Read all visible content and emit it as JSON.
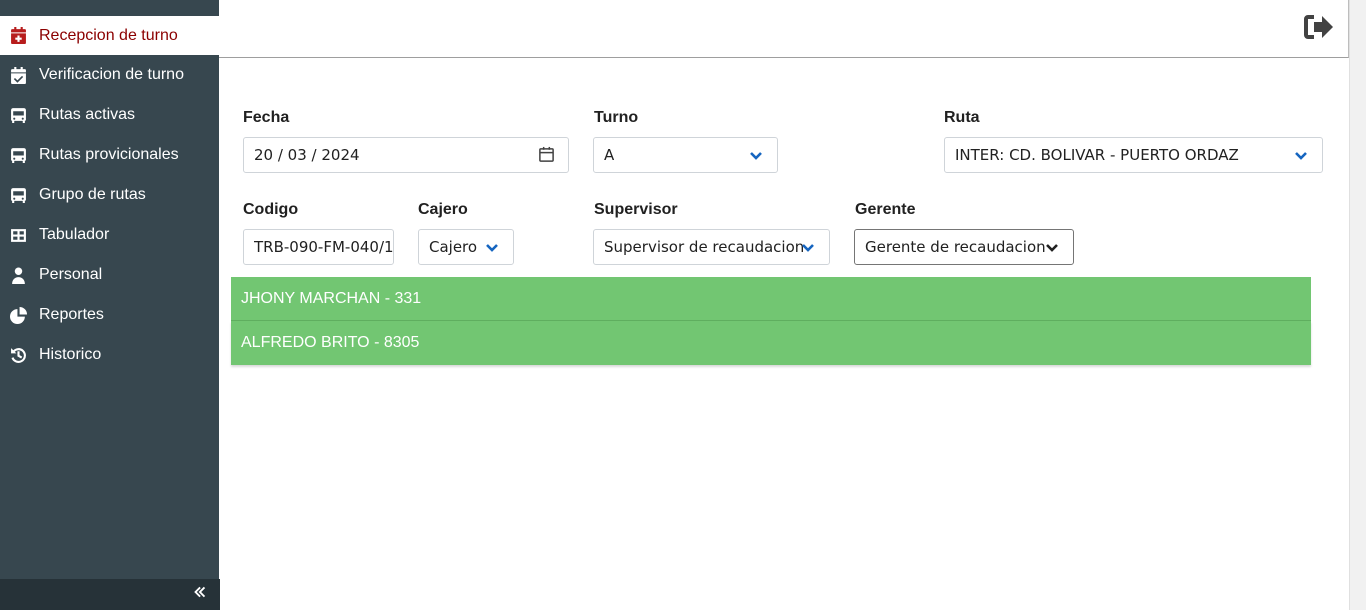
{
  "sidebar": {
    "items": [
      {
        "label": "Recepcion de turno",
        "icon": "calendar-plus-icon",
        "active": true
      },
      {
        "label": "Verificacion de turno",
        "icon": "calendar-check-icon"
      },
      {
        "label": "Rutas activas",
        "icon": "bus-icon"
      },
      {
        "label": "Rutas provicionales",
        "icon": "bus-icon"
      },
      {
        "label": "Grupo de rutas",
        "icon": "bus-icon"
      },
      {
        "label": "Tabulador",
        "icon": "table-icon"
      },
      {
        "label": "Personal",
        "icon": "user-tie-icon"
      },
      {
        "label": "Reportes",
        "icon": "chart-pie-icon"
      },
      {
        "label": "Historico",
        "icon": "history-icon"
      }
    ],
    "collapse_icon": "double-chevron-left-icon"
  },
  "header": {
    "logout_icon": "sign-out-icon"
  },
  "form": {
    "fecha": {
      "label": "Fecha",
      "value": "20 / 03 / 2024"
    },
    "turno": {
      "label": "Turno",
      "value": "A"
    },
    "ruta": {
      "label": "Ruta",
      "value": "INTER: CD. BOLIVAR - PUERTO ORDAZ"
    },
    "codigo": {
      "label": "Codigo",
      "value": "TRB-090-FM-040/1"
    },
    "cajero": {
      "label": "Cajero",
      "value": "Cajero"
    },
    "supervisor": {
      "label": "Supervisor",
      "value": "Supervisor de recaudacion"
    },
    "gerente": {
      "label": "Gerente",
      "value": "Gerente de recaudacion"
    }
  },
  "results": [
    {
      "label": "JHONY MARCHAN - 331"
    },
    {
      "label": "ALFREDO BRITO - 8305"
    }
  ],
  "colors": {
    "sidebar_bg": "#37474f",
    "active_text": "#8b0000",
    "result_bg": "#72c672",
    "chevron": "#1565c0"
  }
}
